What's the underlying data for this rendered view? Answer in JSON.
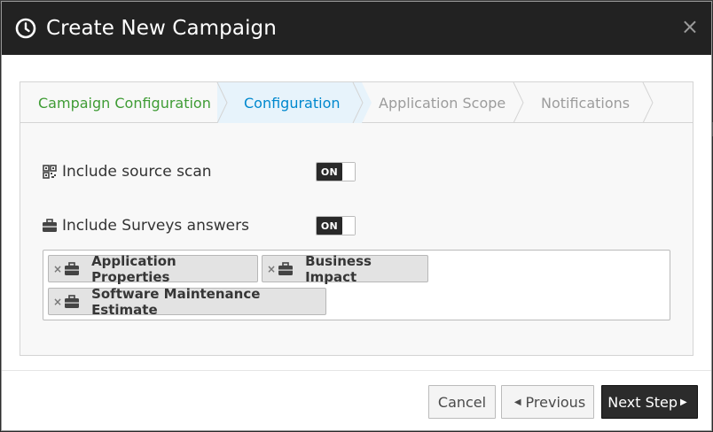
{
  "modal": {
    "title": "Create New Campaign",
    "close_label": "×"
  },
  "wizard": {
    "steps": [
      {
        "label": "Campaign Configuration",
        "state": "done"
      },
      {
        "label": "Configuration",
        "state": "active"
      },
      {
        "label": "Application Scope",
        "state": "todo"
      },
      {
        "label": "Notifications",
        "state": "todo"
      }
    ]
  },
  "form": {
    "source_scan": {
      "label": "Include source scan",
      "toggle": "ON",
      "icon": "qrcode-icon"
    },
    "surveys": {
      "label": "Include Surveys answers",
      "toggle": "ON",
      "icon": "briefcase-icon"
    },
    "survey_tags": [
      {
        "remove": "×",
        "label": "Application Properties"
      },
      {
        "remove": "×",
        "label": "Business Impact"
      },
      {
        "remove": "×",
        "label": "Software Maintenance Estimate"
      }
    ]
  },
  "footer": {
    "cancel_label": "Cancel",
    "previous_label": "Previous",
    "next_label": "Next Step"
  },
  "colors": {
    "done_step": "#3f9c35",
    "active_step": "#0088ce",
    "header_bg": "#222222"
  }
}
